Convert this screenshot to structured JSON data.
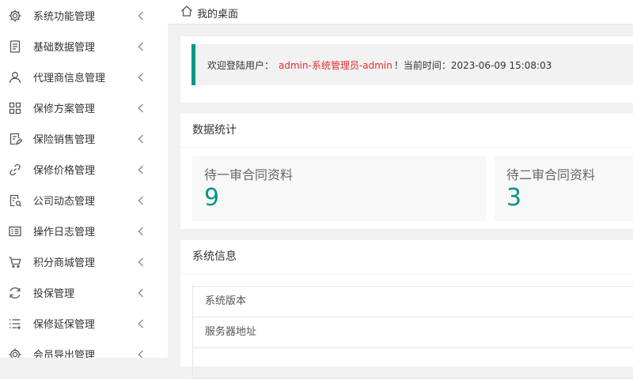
{
  "sidebar": {
    "items": [
      {
        "label": "系统功能管理",
        "icon": "gear-icon"
      },
      {
        "label": "基础数据管理",
        "icon": "document-icon"
      },
      {
        "label": "代理商信息管理",
        "icon": "user-icon"
      },
      {
        "label": "保修方案管理",
        "icon": "grid-icon"
      },
      {
        "label": "保险销售管理",
        "icon": "file-edit-icon"
      },
      {
        "label": "保修价格管理",
        "icon": "link-icon"
      },
      {
        "label": "公司动态管理",
        "icon": "doc-pen-icon"
      },
      {
        "label": "操作日志管理",
        "icon": "log-icon"
      },
      {
        "label": "积分商城管理",
        "icon": "cart-icon"
      },
      {
        "label": "投保管理",
        "icon": "refresh-icon"
      },
      {
        "label": "保修延保管理",
        "icon": "list-icon"
      },
      {
        "label": "会员导出管理",
        "icon": "gear-icon"
      }
    ]
  },
  "breadcrumb": {
    "label": "我的桌面"
  },
  "welcome": {
    "prefix": "欢迎登陆用户：",
    "user": "admin-系统管理员-admin",
    "suffix": "！当前时间：2023-06-09 15:08:03"
  },
  "stats": {
    "title": "数据统计",
    "items": [
      {
        "label": "待一审合同资料",
        "value": "9"
      },
      {
        "label": "待二审合同资料",
        "value": "3"
      }
    ]
  },
  "system_info": {
    "title": "系统信息",
    "rows": [
      {
        "label": "系统版本"
      },
      {
        "label": "服务器地址"
      },
      {
        "label": ""
      }
    ]
  },
  "colors": {
    "accent": "#009688",
    "highlight": "#e22c2c",
    "background": "#f1f1f1"
  }
}
